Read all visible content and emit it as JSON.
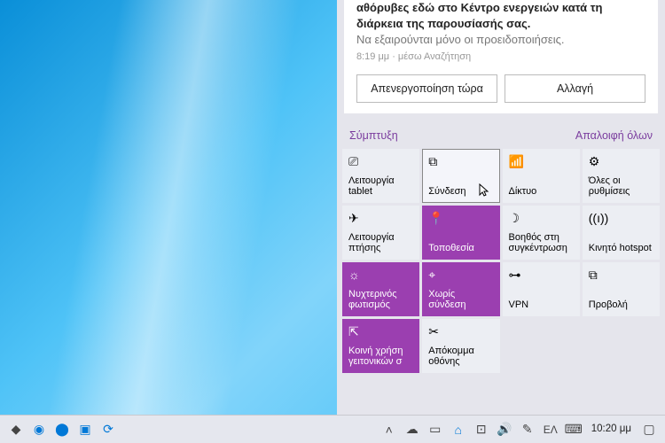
{
  "notification": {
    "line1": "αθόρυβες εδώ στο Κέντρο ενεργειών κατά τη διάρκεια της παρουσίασής σας.",
    "line2": "Να εξαιρούνται μόνο οι προειδοποιήσεις.",
    "meta": "8:19 μμ · μέσω Αναζήτηση",
    "btn1": "Απενεργοποίηση τώρα",
    "btn2": "Αλλαγή"
  },
  "links": {
    "collapse": "Σύμπτυξη",
    "clearAll": "Απαλοιφή όλων"
  },
  "tiles": [
    {
      "label": "Λειτουργία tablet",
      "active": false
    },
    {
      "label": "Σύνδεση",
      "active": false,
      "hover": true
    },
    {
      "label": "Δίκτυο",
      "active": false
    },
    {
      "label": "Όλες οι ρυθμίσεις",
      "active": false
    },
    {
      "label": "Λειτουργία πτήσης",
      "active": false
    },
    {
      "label": "Τοποθεσία",
      "active": true
    },
    {
      "label": "Βοηθός στη συγκέντρωση",
      "active": false
    },
    {
      "label": "Κινητό hotspot",
      "active": false
    },
    {
      "label": "Νυχτερινός φωτισμός",
      "active": true
    },
    {
      "label": "Χωρίς σύνδεση",
      "active": true
    },
    {
      "label": "VPN",
      "active": false
    },
    {
      "label": "Προβολή",
      "active": false
    },
    {
      "label": "Κοινή χρήση γειτονικών σ",
      "active": true
    },
    {
      "label": "Απόκομμα οθόνης",
      "active": false
    }
  ],
  "taskbar": {
    "lang": "ΕΛ",
    "time": "10:20 μμ"
  }
}
